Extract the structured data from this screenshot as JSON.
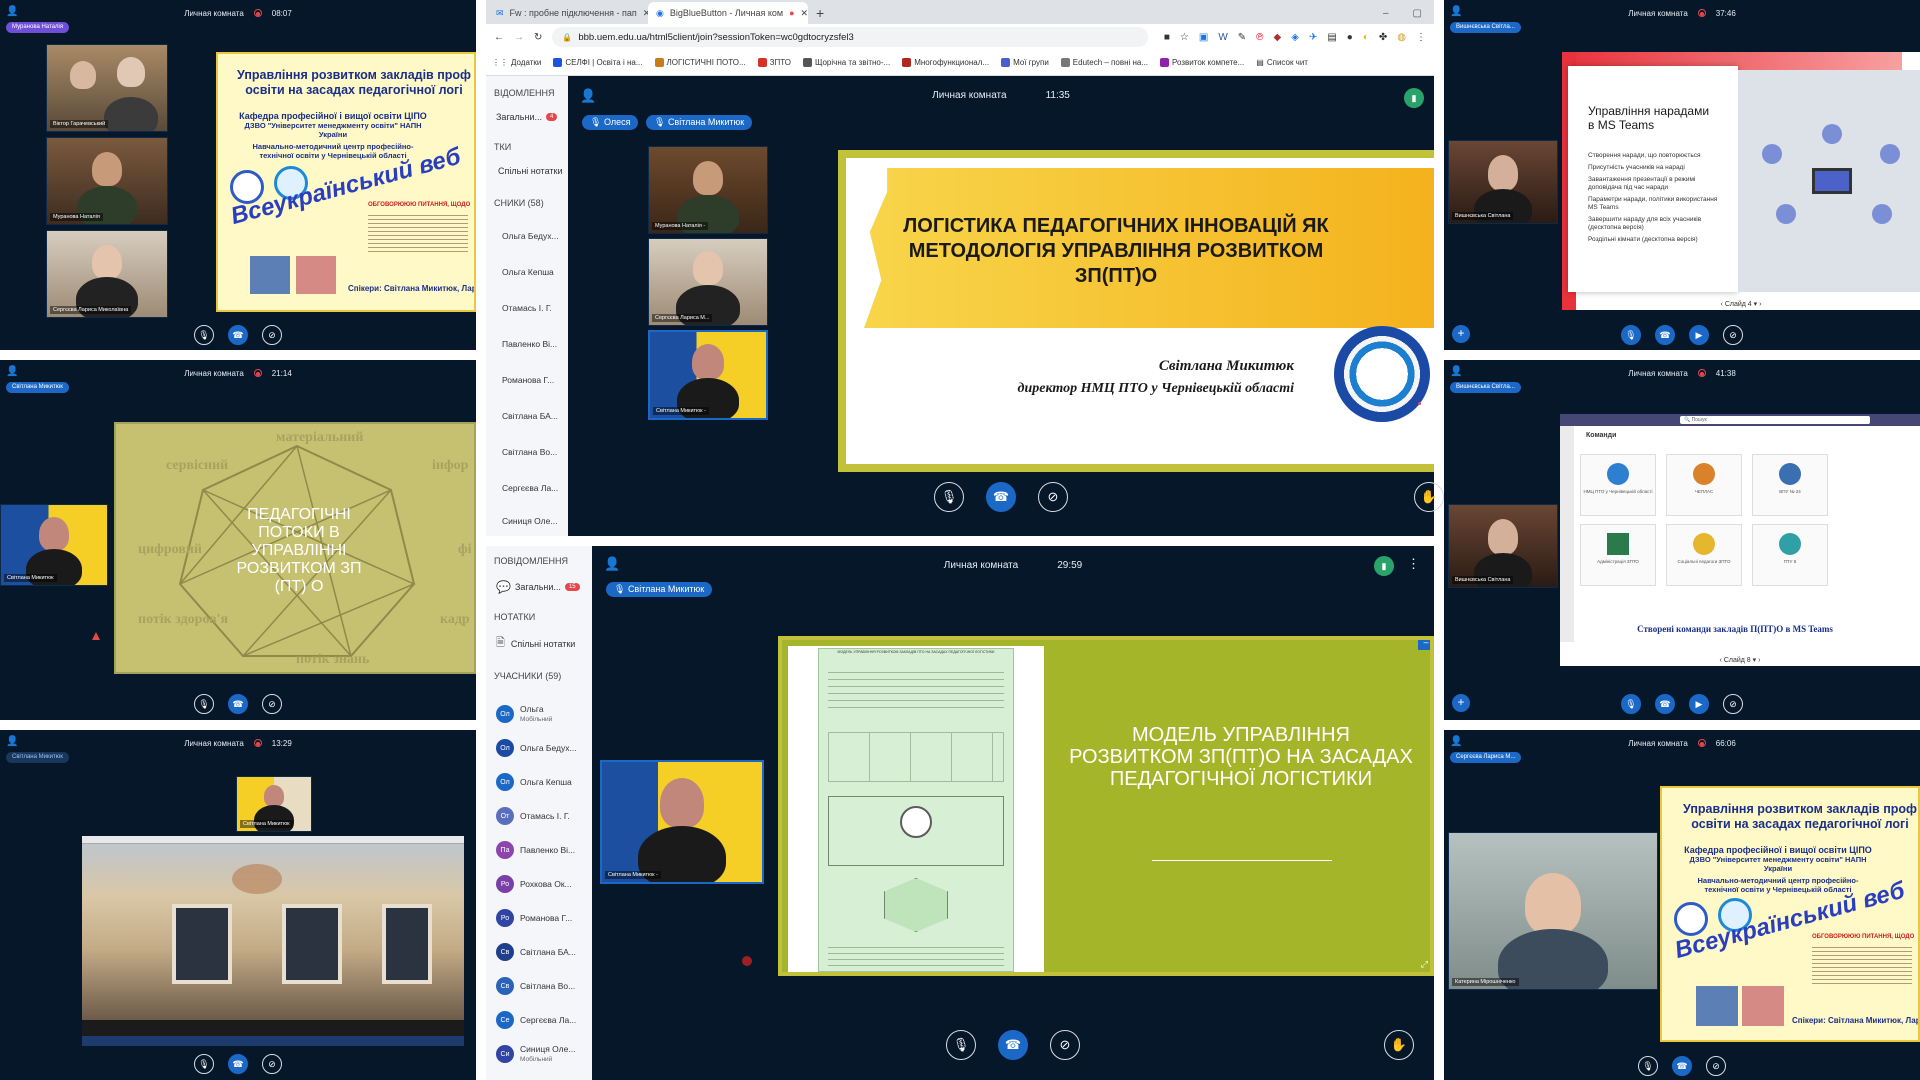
{
  "room_title": "Личная комната",
  "tiles": {
    "tl": {
      "presenter": "Муранова Наталія",
      "time": "08:07",
      "cams": [
        "Віктор Гарачевський",
        "Муранова Наталія",
        "Сергєєва Лариса Миколаївна"
      ],
      "slide": {
        "title1": "Управління розвитком закладів проф",
        "title2": "освіти на засадах педагогічної логі",
        "dept1": "Кафедра професійної і вищої освіти ЦІПО",
        "dept2": "ДЗВО \"Університет менеджменту освіти\" НАПН",
        "dept3": "України",
        "center1": "Навчально-методичний центр професійно-",
        "center2": "технічної освіти у Чернівецькій області",
        "banner": "Всеукраїнський веб",
        "speakers": "Спікери: Світлана Микитюк, Лар",
        "discuss": "ОБГОВОРЮЮЮ ПИТАННЯ, ЩОДО"
      }
    },
    "ml": {
      "presenter": "Світлана Микитюк",
      "time": "21:14",
      "cam": "Світлана Микитюк",
      "words": [
        "матеріальний",
        "сервісний",
        "інфор",
        "цифровий",
        "фі",
        "потік здоров'я",
        "потік знань",
        "кадр"
      ],
      "center": "ПЕДАГОГІЧНІ ПОТОКИ В УПРАВЛІННІ РОЗВИТКОМ ЗП (ПТ) О"
    },
    "bl": {
      "presenter": "Світлана Микитюк",
      "time": "13:29",
      "cam": "Світлана Микитюк"
    },
    "tr": {
      "presenter": "Вишнєвська Світла...",
      "time": "37:46",
      "cam": "Вишнєвська Світлана",
      "slide_title": "Управління нарадами в MS Teams",
      "bullets": [
        "Створення наради, що повторюється",
        "Присутність учасників на нараді",
        "Завантаження презентації в режимі доповідача під час наради",
        "Параметри наради, політики використання MS Teams",
        "Завершити нараду для всіх учасників (десктопна версія)",
        "Роздільні кімнати (десктопна версія)"
      ],
      "nav": "Слайд 4"
    },
    "mr": {
      "presenter": "Вишнєвська Світла...",
      "time": "41:38",
      "cam": "Вишнєвська Світлана",
      "search": "Пошук",
      "teams_label": "Команди",
      "teams": [
        "НМЦ ПТО у Чернівецькій області",
        "ЧЕПЛАС",
        "ВПУ № 24",
        "Адміністрація ЗПТО",
        "Соціальні педагоги ЗПТО",
        "ПТУ 8"
      ],
      "caption": "Створені команди закладів П(ПТ)О в MS Teams",
      "nav": "Слайд 8"
    },
    "br": {
      "presenter": "Сергєєва Лариса М...",
      "time": "66:06",
      "cam": "Катерина Мірошніченко",
      "slide": {
        "title1": "Управління розвитком закладів проф",
        "title2": "освіти на засадах педагогічної логі",
        "dept1": "Кафедра професійної і вищої освіти ЦІПО",
        "dept2": "ДЗВО \"Університет менеджменту освіти\" НАПН",
        "dept3": "України",
        "center1": "Навчально-методичний центр професійно-",
        "center2": "технічної освіти у Чернівецькій області",
        "banner": "Всеукраїнський веб",
        "speakers": "Спікери: Світлана Микитюк, Лар",
        "discuss": "ОБГОВОРЮЮЮ ПИТАННЯ, ЩОДО"
      }
    }
  },
  "browser": {
    "tabs": [
      "Fw : пробне підключення - пап",
      "BigBlueButton - Личная ком"
    ],
    "url": "bbb.uem.edu.ua/html5client/join?sessionToken=wc0gdtocryzsfel3",
    "bookmarks": [
      "Додатки",
      "СЕЛФІ | Освіта і на...",
      "ЛОГІСТИЧНІ ПОТО...",
      "ЗПТО",
      "Щорічна та звітно-...",
      "Многофункционал...",
      "Мої групи",
      "Edutech – повні на...",
      "Розвиток компете...",
      "Список чит"
    ]
  },
  "tc": {
    "time": "11:35",
    "pills": [
      "Олеся",
      "Світлана Микитюк"
    ],
    "sidebar": {
      "notices_head": "ВІДОМЛЕННЯ",
      "general": "Загальни...",
      "badge": "4",
      "notes_head": "ТКИ",
      "shared": "Спільні нотатки",
      "parts_head": "СНИКИ (58)",
      "participants": [
        "Ольга Бедух...",
        "Ольга Кепша",
        "Отамась І. Г.",
        "Павленко Ві...",
        "Романова Г...",
        "Світлана БА...",
        "Світлана Во...",
        "Сергєєва Ла...",
        "Синиця Оле..."
      ]
    },
    "cams": [
      "Муранова Наталія -",
      "Сергєєва Лариса М...",
      "Світлана Микитюк -"
    ],
    "slide_title": "ЛОГІСТИКА ПЕДАГОГІЧНИХ ІННОВАЦІЙ ЯК МЕТОДОЛОГІЯ УПРАВЛІННЯ РОЗВИТКОМ ЗП(ПТ)О",
    "author": "Світлана Микитюк",
    "author_role": "директор НМЦ ПТО у Чернівецькій області"
  },
  "bc": {
    "time": "29:59",
    "pill": "Світлана Микитюк",
    "sidebar": {
      "notices_head": "ПОВІДОМЛЕННЯ",
      "general": "Загальни...",
      "badge": "15",
      "notes_head": "НОТАТКИ",
      "shared": "Спільні нотатки",
      "parts_head": "УЧАСНИКИ (59)",
      "participants": [
        {
          "init": "Ол",
          "name": "Ольга",
          "sub": "Мобільний"
        },
        {
          "init": "Ол",
          "name": "Ольга Бедух...",
          "sub": ""
        },
        {
          "init": "Ол",
          "name": "Ольга Кепша",
          "sub": ""
        },
        {
          "init": "От",
          "name": "Отамась І. Г.",
          "sub": ""
        },
        {
          "init": "Па",
          "name": "Павленко Ві...",
          "sub": ""
        },
        {
          "init": "Ро",
          "name": "Рохкова Ок...",
          "sub": ""
        },
        {
          "init": "Ро",
          "name": "Романова Г...",
          "sub": ""
        },
        {
          "init": "Св",
          "name": "Світлана БА...",
          "sub": ""
        },
        {
          "init": "Св",
          "name": "Світлана Во...",
          "sub": ""
        },
        {
          "init": "Се",
          "name": "Сергєєва Ла...",
          "sub": ""
        },
        {
          "init": "Си",
          "name": "Синиця Оле...",
          "sub": "Мобільний"
        }
      ]
    },
    "cam": "Світлана Микитюк -",
    "slide_title": "МОДЕЛЬ УПРАВЛІННЯ РОЗВИТКОМ ЗП(ПТ)О НА ЗАСАДАХ ПЕДАГОГІЧНОЇ ЛОГІСТИКИ",
    "diagram_title": "МОДЕЛЬ УПРАВЛІННЯ РОЗВИТКОМ ЗАКЛАДІВ ПТО НА ЗАСАДАХ ПЕДАГОГІЧНОЇ ЛОГІСТИКИ"
  }
}
